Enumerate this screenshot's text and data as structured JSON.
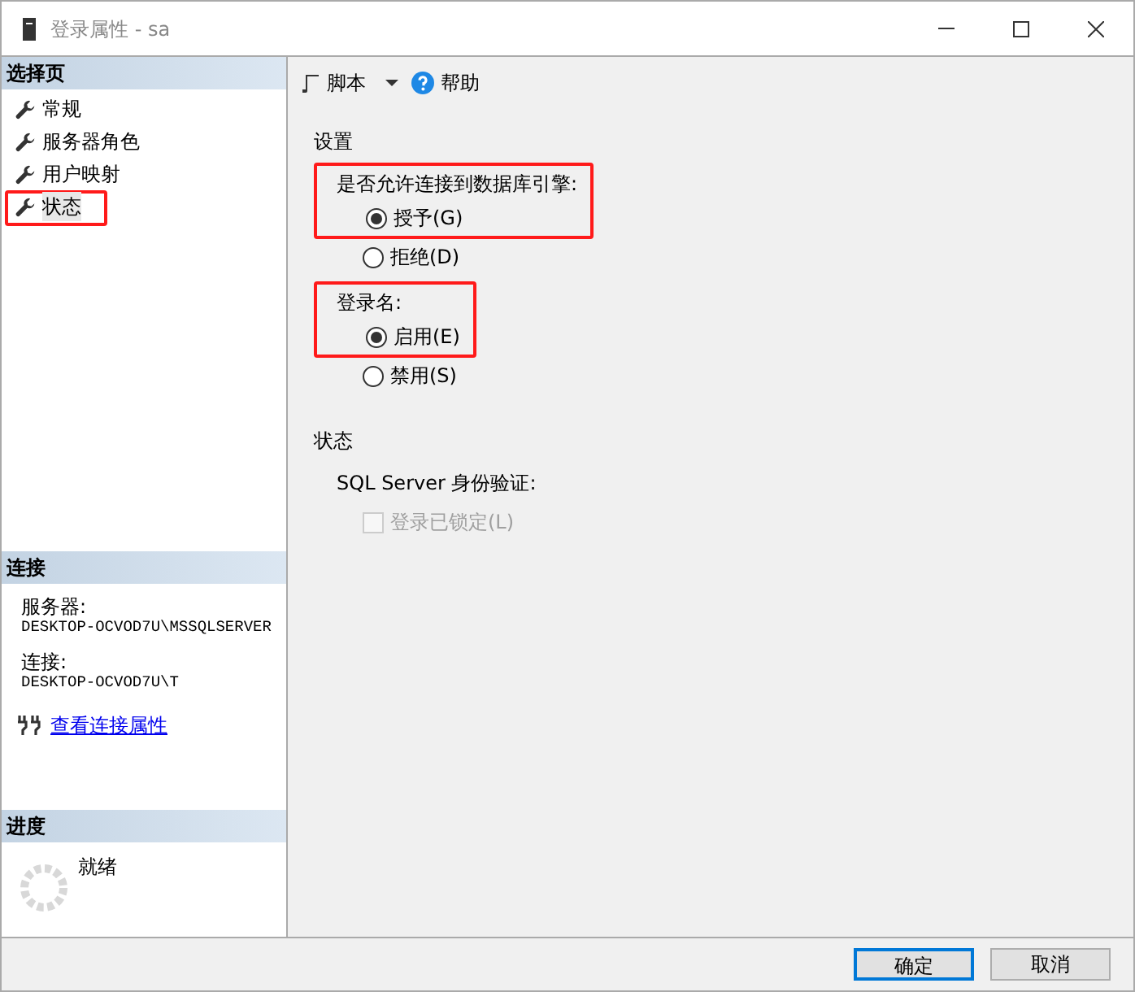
{
  "window": {
    "title": "登录属性 - sa"
  },
  "select_page": {
    "title": "选择页",
    "items": [
      {
        "label": "常规",
        "selected": false,
        "highlighted": false
      },
      {
        "label": "服务器角色",
        "selected": false,
        "highlighted": false
      },
      {
        "label": "用户映射",
        "selected": false,
        "highlighted": false
      },
      {
        "label": "状态",
        "selected": true,
        "highlighted": true
      }
    ]
  },
  "connection": {
    "title": "连接",
    "server_label": "服务器:",
    "server": "DESKTOP-OCVOD7U\\MSSQLSERVER",
    "connection_label": "连接:",
    "connection": "DESKTOP-OCVOD7U\\T",
    "link": "查看连接属性"
  },
  "progress": {
    "title": "进度",
    "status": "就绪"
  },
  "toolbar": {
    "script": "脚本",
    "help": "帮助"
  },
  "settings": {
    "title": "设置",
    "groups": [
      {
        "label": "是否允许连接到数据库引擎:",
        "highlighted": true,
        "options": [
          {
            "label": "授予(G)",
            "selected": true,
            "highlighted": true
          },
          {
            "label": "拒绝(D)",
            "selected": false,
            "highlighted": false
          }
        ]
      },
      {
        "label": "登录名:",
        "highlighted": true,
        "options": [
          {
            "label": "启用(E)",
            "selected": true,
            "highlighted": true
          },
          {
            "label": "禁用(S)",
            "selected": false,
            "highlighted": false
          }
        ]
      }
    ]
  },
  "status": {
    "title": "状态",
    "auth_label": "SQL Server 身份验证:",
    "locked": {
      "label": "登录已锁定(L)",
      "checked": false,
      "disabled": true
    }
  },
  "buttons": [
    {
      "label": "确定",
      "default": true
    },
    {
      "label": "取消",
      "default": false
    }
  ]
}
